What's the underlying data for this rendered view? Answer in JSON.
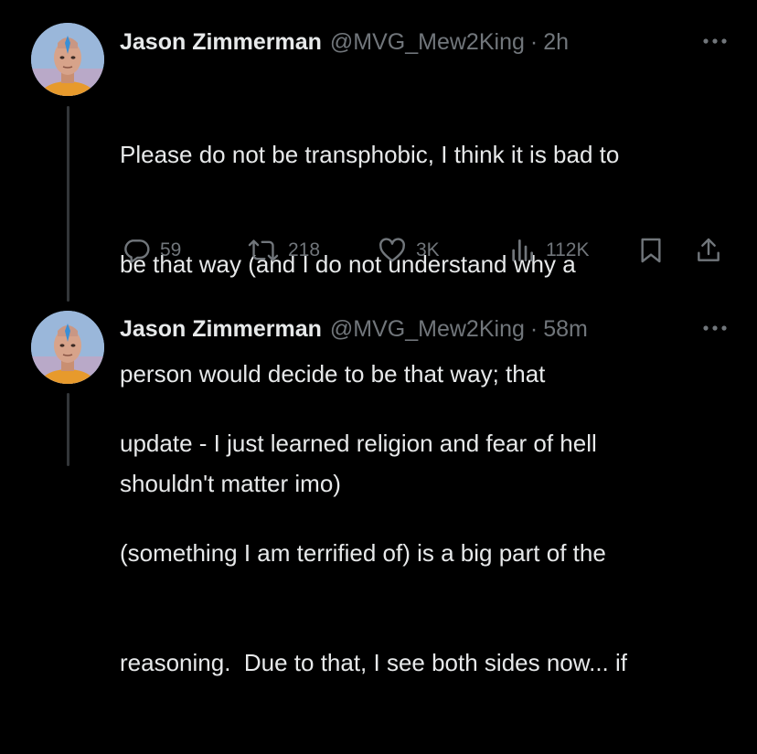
{
  "tweets": [
    {
      "author_name": "Jason Zimmerman",
      "handle": "@MVG_Mew2King",
      "separator": "·",
      "time": "2h",
      "text": "Please do not be transphobic, I think it is bad to be that way (and I do not understand why a person would decide to be that way; that shouldn't matter imo)",
      "lines": [
        "Please do not be transphobic, I think it is bad to",
        "be that way (and I do not understand why a",
        "person would decide to be that way; that",
        "shouldn't matter imo)"
      ],
      "replies": "59",
      "retweets": "218",
      "likes": "3K",
      "views": "112K"
    },
    {
      "author_name": "Jason Zimmerman",
      "handle": "@MVG_Mew2King",
      "separator": "·",
      "time": "58m",
      "lines": [
        "update - I just learned religion and fear of hell",
        "(something I am terrified of) is a big part of the",
        "reasoning.  Due to that, I see both sides now... if"
      ]
    }
  ],
  "colors": {
    "background": "#000000",
    "text_primary": "#e7e9ea",
    "text_secondary": "#71767b",
    "thread_line": "#333639"
  },
  "icons": [
    "more-dots-icon",
    "reply-icon",
    "retweet-icon",
    "like-icon",
    "views-icon",
    "bookmark-icon",
    "share-icon"
  ]
}
